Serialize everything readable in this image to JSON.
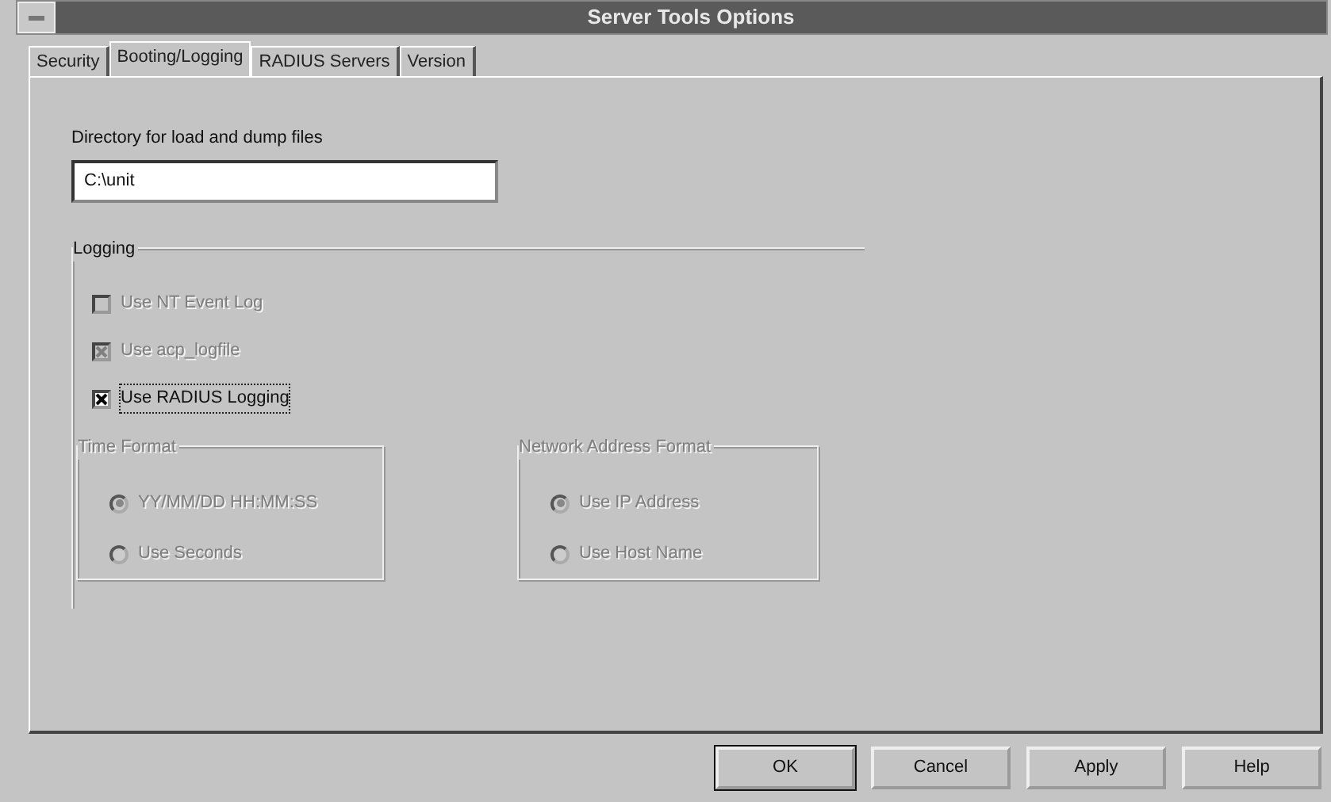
{
  "window": {
    "title": "Server Tools Options"
  },
  "tabs": [
    {
      "label": "Security",
      "selected": false
    },
    {
      "label": "Booting/Logging",
      "selected": true
    },
    {
      "label": "RADIUS Servers",
      "selected": false
    },
    {
      "label": "Version",
      "selected": false
    }
  ],
  "directory": {
    "label": "Directory for load and dump files",
    "value": "C:\\unit"
  },
  "logging": {
    "title": "Logging",
    "checkboxes": [
      {
        "label": "Use NT Event Log",
        "checked": false,
        "disabled": true,
        "focused": false
      },
      {
        "label": "Use acp_logfile",
        "checked": true,
        "disabled": true,
        "focused": false
      },
      {
        "label": "Use RADIUS Logging",
        "checked": true,
        "disabled": false,
        "focused": true
      }
    ],
    "groups": [
      {
        "title": "Time Format",
        "options": [
          {
            "label": "YY/MM/DD HH:MM:SS",
            "selected": true,
            "disabled": true
          },
          {
            "label": "Use Seconds",
            "selected": false,
            "disabled": true
          }
        ]
      },
      {
        "title": "Network Address Format",
        "options": [
          {
            "label": "Use IP Address",
            "selected": true,
            "disabled": true
          },
          {
            "label": "Use Host Name",
            "selected": false,
            "disabled": true
          }
        ]
      }
    ]
  },
  "buttons": [
    {
      "label": "OK",
      "default": true
    },
    {
      "label": "Cancel",
      "default": false
    },
    {
      "label": "Apply",
      "default": false
    },
    {
      "label": "Help",
      "default": false
    }
  ]
}
